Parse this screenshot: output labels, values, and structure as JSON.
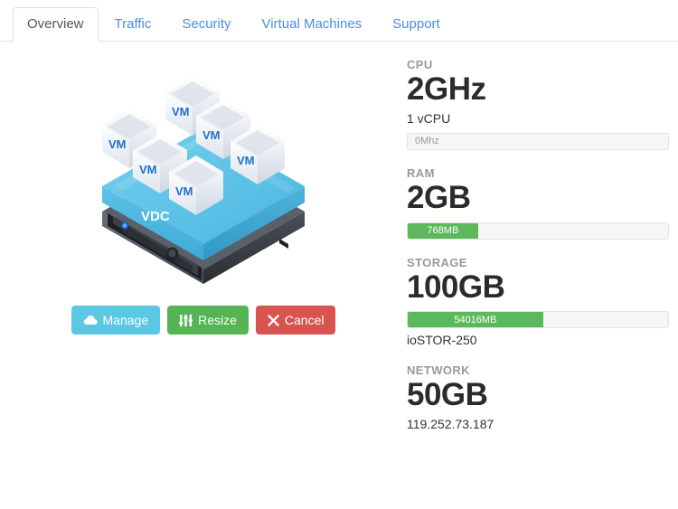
{
  "tabs": [
    {
      "label": "Overview",
      "active": true
    },
    {
      "label": "Traffic",
      "active": false
    },
    {
      "label": "Security",
      "active": false
    },
    {
      "label": "Virtual Machines",
      "active": false
    },
    {
      "label": "Support",
      "active": false
    }
  ],
  "illustration": {
    "platform_label": "VDC",
    "vm_label": "VM",
    "vm_count": 6,
    "slab_color": "#54c0e8",
    "chassis_color": "#3b3f46",
    "led_color": "#2f7df6"
  },
  "actions": {
    "manage": {
      "label": "Manage",
      "icon": "cloud-icon",
      "color": "#5bc8e3"
    },
    "resize": {
      "label": "Resize",
      "icon": "sliders-icon",
      "color": "#55b555"
    },
    "cancel": {
      "label": "Cancel",
      "icon": "close-icon",
      "color": "#d9534f"
    }
  },
  "stats": {
    "cpu": {
      "label": "CPU",
      "value": "2GHz",
      "sub": "1 vCPU",
      "usage_text": "0Mhz",
      "usage_percent": 0
    },
    "ram": {
      "label": "RAM",
      "value": "2GB",
      "usage_text": "768MB",
      "usage_percent": 27
    },
    "storage": {
      "label": "STORAGE",
      "value": "100GB",
      "usage_text": "54016MB",
      "usage_percent": 52,
      "sub": "ioSTOR-250"
    },
    "network": {
      "label": "NETWORK",
      "value": "50GB",
      "sub": "119.252.73.187"
    }
  }
}
